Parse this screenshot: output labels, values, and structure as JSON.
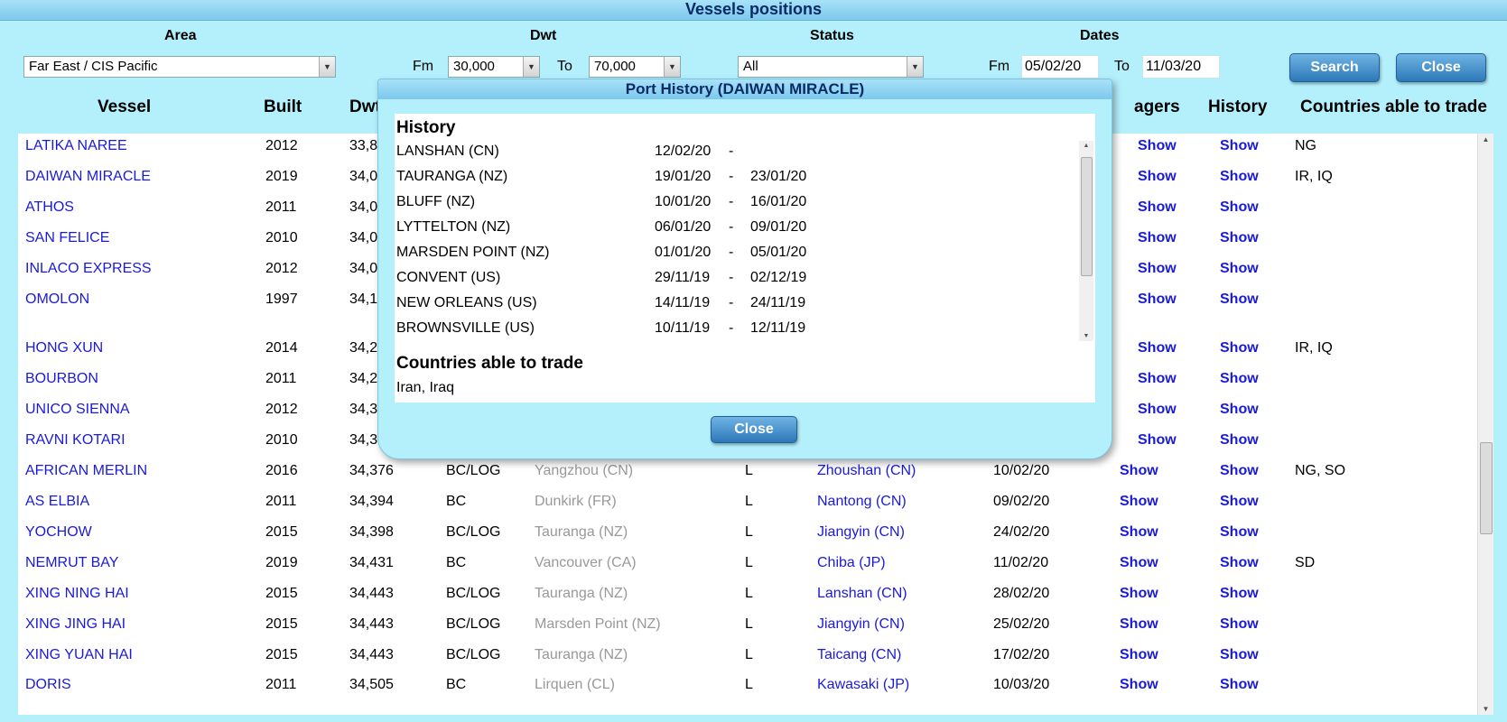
{
  "title": "Vessels positions",
  "filters": {
    "area_label": "Area",
    "area_value": "Far East / CIS Pacific",
    "dwt_label": "Dwt",
    "dwt_fm_label": "Fm",
    "dwt_fm_value": "30,000",
    "dwt_to_label": "To",
    "dwt_to_value": "70,000",
    "status_label": "Status",
    "status_value": "All",
    "dates_label": "Dates",
    "dates_fm_label": "Fm",
    "dates_fm_value": "05/02/20",
    "dates_to_label": "To",
    "dates_to_value": "11/03/20",
    "search_label": "Search",
    "close_label": "Close"
  },
  "columns": {
    "vessel": "Vessel",
    "built": "Built",
    "dwt": "Dwt",
    "voyagers": "agers",
    "history": "History",
    "countries": "Countries able to trade"
  },
  "rows": [
    {
      "vessel": "LATIKA NAREE",
      "built": "2012",
      "dwt": "33,8",
      "type": "",
      "prev": "",
      "st": "",
      "next": "",
      "date": "",
      "voy": "Show",
      "hist": "Show",
      "countries": "NG"
    },
    {
      "vessel": "DAIWAN MIRACLE",
      "built": "2019",
      "dwt": "34,0",
      "type": "",
      "prev": "",
      "st": "",
      "next": "",
      "date": "",
      "voy": "Show",
      "hist": "Show",
      "countries": "IR, IQ"
    },
    {
      "vessel": "ATHOS",
      "built": "2011",
      "dwt": "34,0",
      "type": "",
      "prev": "",
      "st": "",
      "next": "",
      "date": "",
      "voy": "Show",
      "hist": "Show",
      "countries": ""
    },
    {
      "vessel": "SAN FELICE",
      "built": "2010",
      "dwt": "34,0",
      "type": "",
      "prev": "",
      "st": "",
      "next": "",
      "date": "",
      "voy": "Show",
      "hist": "Show",
      "countries": ""
    },
    {
      "vessel": "INLACO EXPRESS",
      "built": "2012",
      "dwt": "34,0",
      "type": "",
      "prev": "",
      "st": "",
      "next": "",
      "date": "",
      "voy": "Show",
      "hist": "Show",
      "countries": ""
    },
    {
      "vessel": "OMOLON",
      "built": "1997",
      "dwt": "34,1",
      "type": "",
      "prev": "",
      "st": "",
      "next": "",
      "date": "",
      "voy": "Show",
      "hist": "Show",
      "countries": ""
    },
    {
      "vessel": "HONG XUN",
      "built": "2014",
      "dwt": "34,2",
      "type": "",
      "prev": "",
      "st": "",
      "next": "",
      "date": "",
      "voy": "Show",
      "hist": "Show",
      "countries": "IR, IQ"
    },
    {
      "vessel": "BOURBON",
      "built": "2011",
      "dwt": "34,2",
      "type": "",
      "prev": "",
      "st": "",
      "next": "",
      "date": "",
      "voy": "Show",
      "hist": "Show",
      "countries": ""
    },
    {
      "vessel": "UNICO SIENNA",
      "built": "2012",
      "dwt": "34,3",
      "type": "",
      "prev": "",
      "st": "",
      "next": "",
      "date": "",
      "voy": "Show",
      "hist": "Show",
      "countries": ""
    },
    {
      "vessel": "RAVNI KOTARI",
      "built": "2010",
      "dwt": "34,3",
      "type": "",
      "prev": "",
      "st": "",
      "next": "",
      "date": "",
      "voy": "Show",
      "hist": "Show",
      "countries": ""
    },
    {
      "vessel": "AFRICAN MERLIN",
      "built": "2016",
      "dwt": "34,376",
      "type": "BC/LOG",
      "prev": "Yangzhou (CN)",
      "st": "L",
      "next": "Zhoushan (CN)",
      "date": "10/02/20",
      "voy": "Show",
      "hist": "Show",
      "countries": "NG, SO"
    },
    {
      "vessel": "AS ELBIA",
      "built": "2011",
      "dwt": "34,394",
      "type": "BC",
      "prev": "Dunkirk (FR)",
      "st": "L",
      "next": "Nantong (CN)",
      "date": "09/02/20",
      "voy": "Show",
      "hist": "Show",
      "countries": ""
    },
    {
      "vessel": "YOCHOW",
      "built": "2015",
      "dwt": "34,398",
      "type": "BC/LOG",
      "prev": "Tauranga (NZ)",
      "st": "L",
      "next": "Jiangyin (CN)",
      "date": "24/02/20",
      "voy": "Show",
      "hist": "Show",
      "countries": ""
    },
    {
      "vessel": "NEMRUT BAY",
      "built": "2019",
      "dwt": "34,431",
      "type": "BC",
      "prev": "Vancouver (CA)",
      "st": "L",
      "next": "Chiba (JP)",
      "date": "11/02/20",
      "voy": "Show",
      "hist": "Show",
      "countries": "SD"
    },
    {
      "vessel": "XING NING HAI",
      "built": "2015",
      "dwt": "34,443",
      "type": "BC/LOG",
      "prev": "Tauranga (NZ)",
      "st": "L",
      "next": "Lanshan (CN)",
      "date": "28/02/20",
      "voy": "Show",
      "hist": "Show",
      "countries": ""
    },
    {
      "vessel": "XING JING HAI",
      "built": "2015",
      "dwt": "34,443",
      "type": "BC/LOG",
      "prev": "Marsden Point (NZ)",
      "st": "L",
      "next": "Jiangyin (CN)",
      "date": "25/02/20",
      "voy": "Show",
      "hist": "Show",
      "countries": ""
    },
    {
      "vessel": "XING YUAN HAI",
      "built": "2015",
      "dwt": "34,443",
      "type": "BC/LOG",
      "prev": "Tauranga (NZ)",
      "st": "L",
      "next": "Taicang (CN)",
      "date": "17/02/20",
      "voy": "Show",
      "hist": "Show",
      "countries": ""
    },
    {
      "vessel": "DORIS",
      "built": "2011",
      "dwt": "34,505",
      "type": "BC",
      "prev": "Lirquen (CL)",
      "st": "L",
      "next": "Kawasaki (JP)",
      "date": "10/03/20",
      "voy": "Show",
      "hist": "Show",
      "countries": ""
    }
  ],
  "modal": {
    "title": "Port History (DAIWAN MIRACLE)",
    "history_heading": "History",
    "history": [
      {
        "port": "LANSHAN (CN)",
        "from": "12/02/20",
        "sep": "-",
        "to": ""
      },
      {
        "port": "TAURANGA (NZ)",
        "from": "19/01/20",
        "sep": "-",
        "to": "23/01/20"
      },
      {
        "port": "BLUFF (NZ)",
        "from": "10/01/20",
        "sep": "-",
        "to": "16/01/20"
      },
      {
        "port": "LYTTELTON (NZ)",
        "from": "06/01/20",
        "sep": "-",
        "to": "09/01/20"
      },
      {
        "port": "MARSDEN POINT (NZ)",
        "from": "01/01/20",
        "sep": "-",
        "to": "05/01/20"
      },
      {
        "port": "CONVENT (US)",
        "from": "29/11/19",
        "sep": "-",
        "to": "02/12/19"
      },
      {
        "port": "NEW ORLEANS (US)",
        "from": "14/11/19",
        "sep": "-",
        "to": "24/11/19"
      },
      {
        "port": "BROWNSVILLE (US)",
        "from": "10/11/19",
        "sep": "-",
        "to": "12/11/19"
      }
    ],
    "countries_heading": "Countries able to trade",
    "countries_value": "Iran, Iraq",
    "close_label": "Close"
  }
}
